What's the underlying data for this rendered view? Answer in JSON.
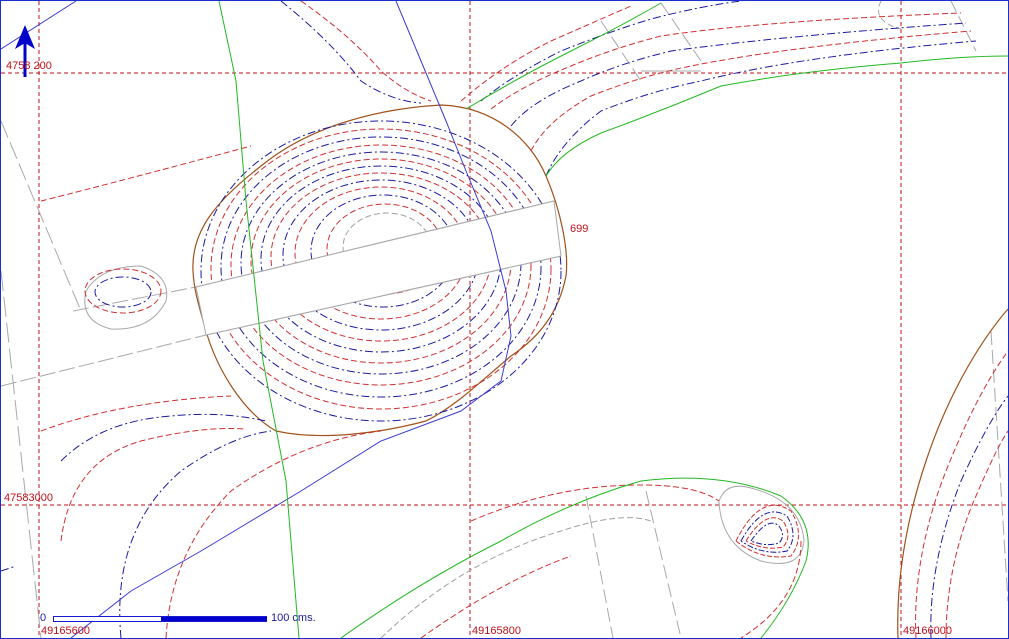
{
  "map": {
    "north_arrow": "north-arrow-icon",
    "grid_labels": {
      "northing_top": "4758 200",
      "northing_mid": "47583000",
      "easting_left": "49165600",
      "easting_mid": "49165800",
      "easting_right": "49166000"
    },
    "contour_label": "699",
    "scale": {
      "zero": "0",
      "label": "100 cms."
    },
    "colors": {
      "grid": "#c0111a",
      "contour_index": "#1a1aa0",
      "contour_intermediate": "#d03030",
      "river": "#3b3bd6",
      "path_green": "#22b822",
      "boundary_brown": "#a0521a",
      "road_gray": "#a0a0a0"
    }
  }
}
